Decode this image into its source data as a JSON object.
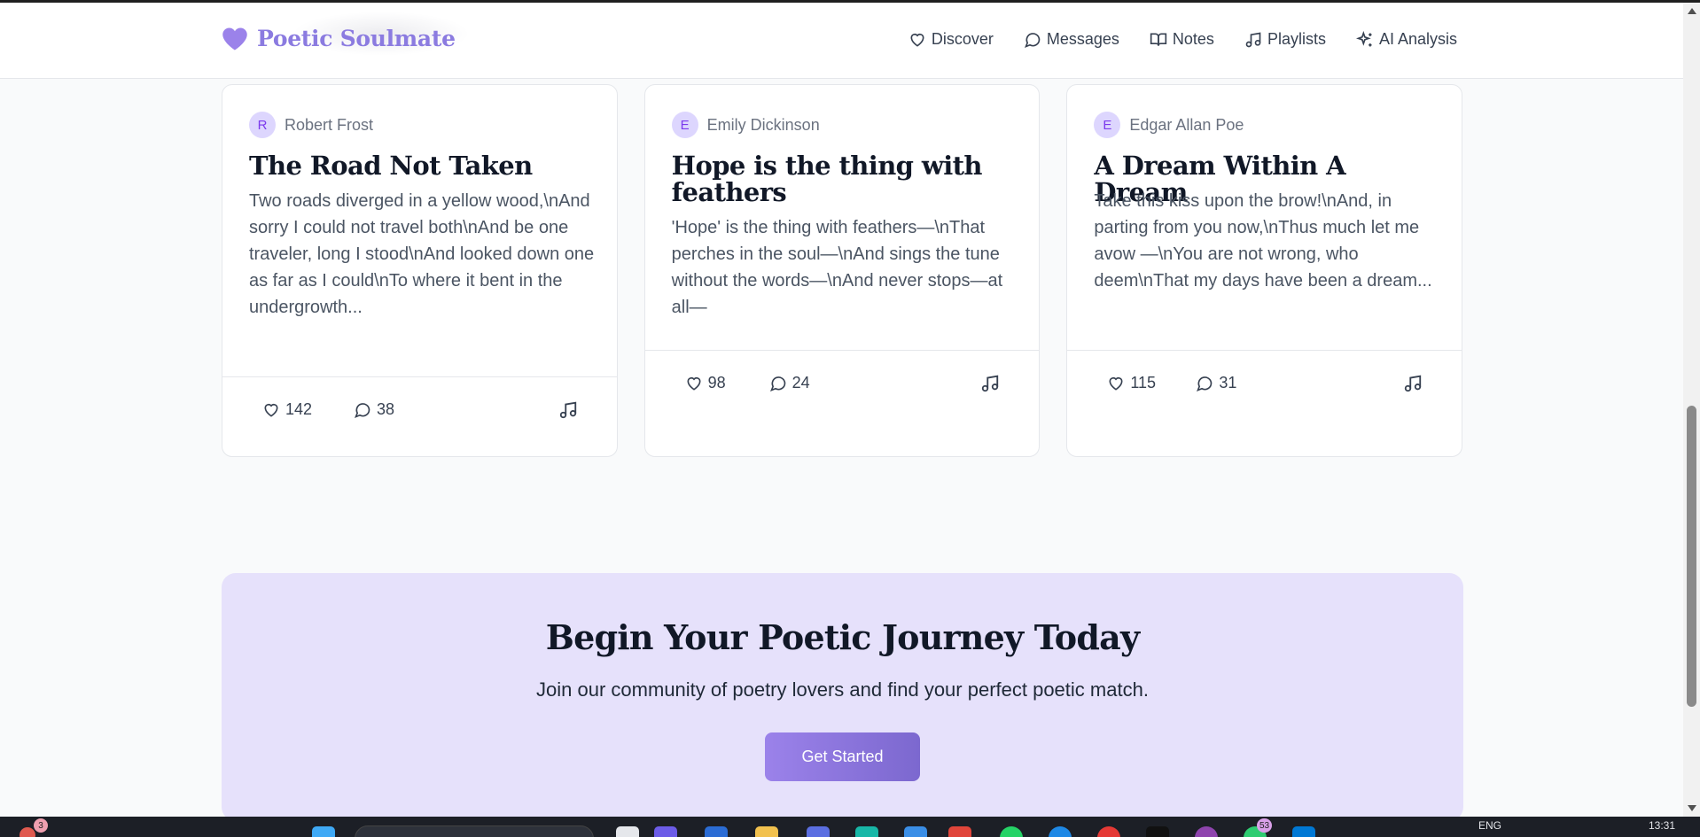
{
  "app": {
    "brand_name": "Poetic Soulmate",
    "brand_icon": "heart-icon",
    "accent_color": "#8b7be0"
  },
  "nav": {
    "items": [
      {
        "label": "Discover",
        "icon": "heart-icon"
      },
      {
        "label": "Messages",
        "icon": "message-circle-icon"
      },
      {
        "label": "Notes",
        "icon": "book-open-icon"
      },
      {
        "label": "Playlists",
        "icon": "music-icon"
      },
      {
        "label": "AI Analysis",
        "icon": "sparkles-icon"
      }
    ]
  },
  "poems": [
    {
      "initial": "R",
      "author": "Robert Frost",
      "title": "The Road Not Taken",
      "excerpt": "Two roads diverged in a yellow wood,\\nAnd sorry I could not travel both\\nAnd be one traveler, long I stood\\nAnd looked down one as far as I could\\nTo where it bent in the undergrowth...",
      "likes": "142",
      "comments": "38"
    },
    {
      "initial": "E",
      "author": "Emily Dickinson",
      "title": "Hope is the thing with feathers",
      "excerpt": "'Hope' is the thing with feathers—\\nThat perches in the soul—\\nAnd sings the tune without the words—\\nAnd never stops—at all—",
      "likes": "98",
      "comments": "24"
    },
    {
      "initial": "E",
      "author": "Edgar Allan Poe",
      "title": "A Dream Within A Dream",
      "excerpt": "Take this kiss upon the brow!\\nAnd, in parting from you now,\\nThus much let me avow —\\nYou are not wrong, who deem\\nThat my days have been a dream...",
      "likes": "115",
      "comments": "31"
    }
  ],
  "cta": {
    "title": "Begin Your Poetic Journey Today",
    "subtitle": "Join our community of poetry lovers and find your perfect poetic match.",
    "button_label": "Get Started"
  },
  "taskbar": {
    "notification_count": "3",
    "app_badge_count": "53",
    "language": "ENG",
    "time": "13:31"
  }
}
